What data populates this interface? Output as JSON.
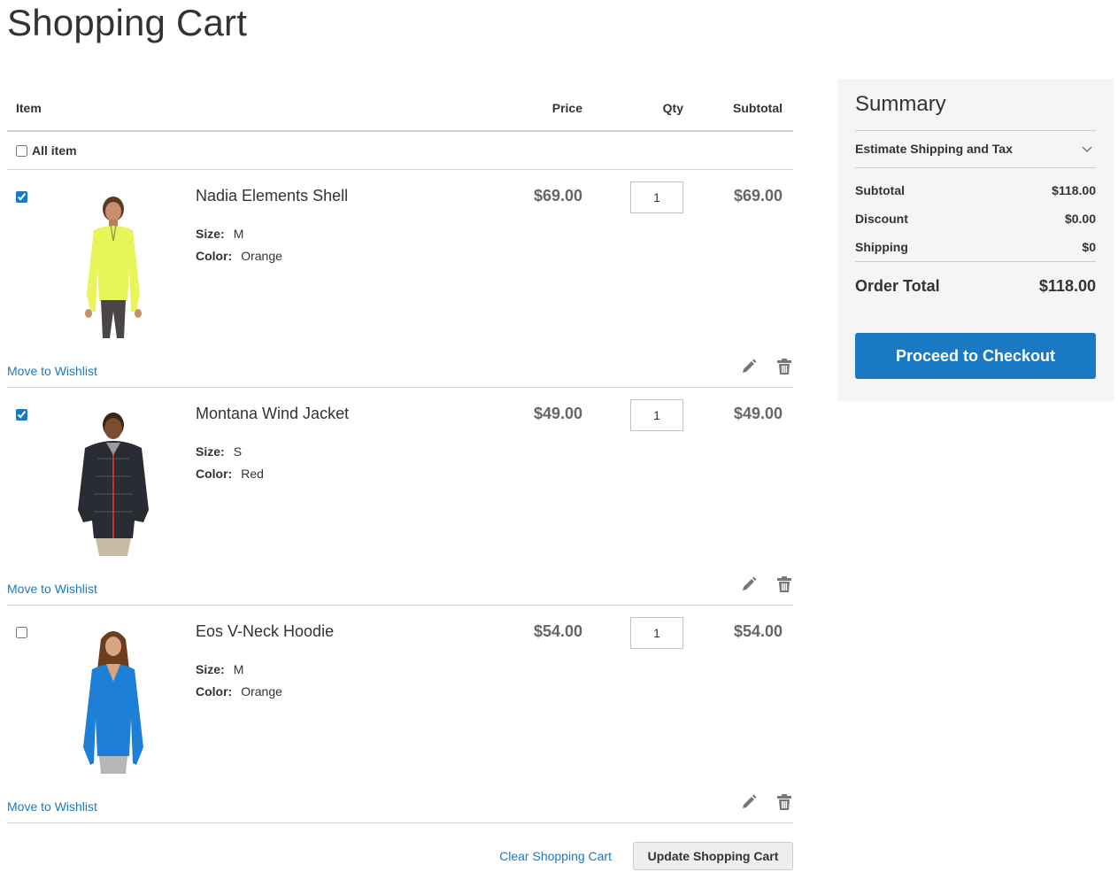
{
  "page": {
    "title": "Shopping Cart"
  },
  "cart": {
    "columns": {
      "item": "Item",
      "price": "Price",
      "qty": "Qty",
      "subtotal": "Subtotal"
    },
    "select_all_label": "All item",
    "items": [
      {
        "name": "Nadia Elements Shell",
        "size_label": "Size:",
        "size": "M",
        "color_label": "Color:",
        "color": "Orange",
        "price": "$69.00",
        "qty": "1",
        "subtotal": "$69.00",
        "checked": true,
        "wishlist_label": "Move to Wishlist"
      },
      {
        "name": "Montana Wind Jacket",
        "size_label": "Size:",
        "size": "S",
        "color_label": "Color:",
        "color": "Red",
        "price": "$49.00",
        "qty": "1",
        "subtotal": "$49.00",
        "checked": true,
        "wishlist_label": "Move to Wishlist"
      },
      {
        "name": "Eos V-Neck Hoodie",
        "size_label": "Size:",
        "size": "M",
        "color_label": "Color:",
        "color": "Orange",
        "price": "$54.00",
        "qty": "1",
        "subtotal": "$54.00",
        "checked": false,
        "wishlist_label": "Move to Wishlist"
      }
    ],
    "clear_label": "Clear Shopping Cart",
    "update_label": "Update Shopping Cart"
  },
  "summary": {
    "title": "Summary",
    "estimate_label": "Estimate Shipping and Tax",
    "rows": [
      {
        "label": "Subtotal",
        "value": "$118.00"
      },
      {
        "label": "Discount",
        "value": "$0.00"
      },
      {
        "label": "Shipping",
        "value": "$0"
      }
    ],
    "grand_label": "Order Total",
    "grand_value": "$118.00",
    "checkout_label": "Proceed to Checkout"
  },
  "icons": {
    "edit": "pencil-icon",
    "delete": "trash-icon",
    "estimate": "chevron-down-icon"
  },
  "colors": {
    "link": "#1979c3",
    "primary_button": "#1979c3",
    "summary_bg": "#f5f5f5"
  }
}
